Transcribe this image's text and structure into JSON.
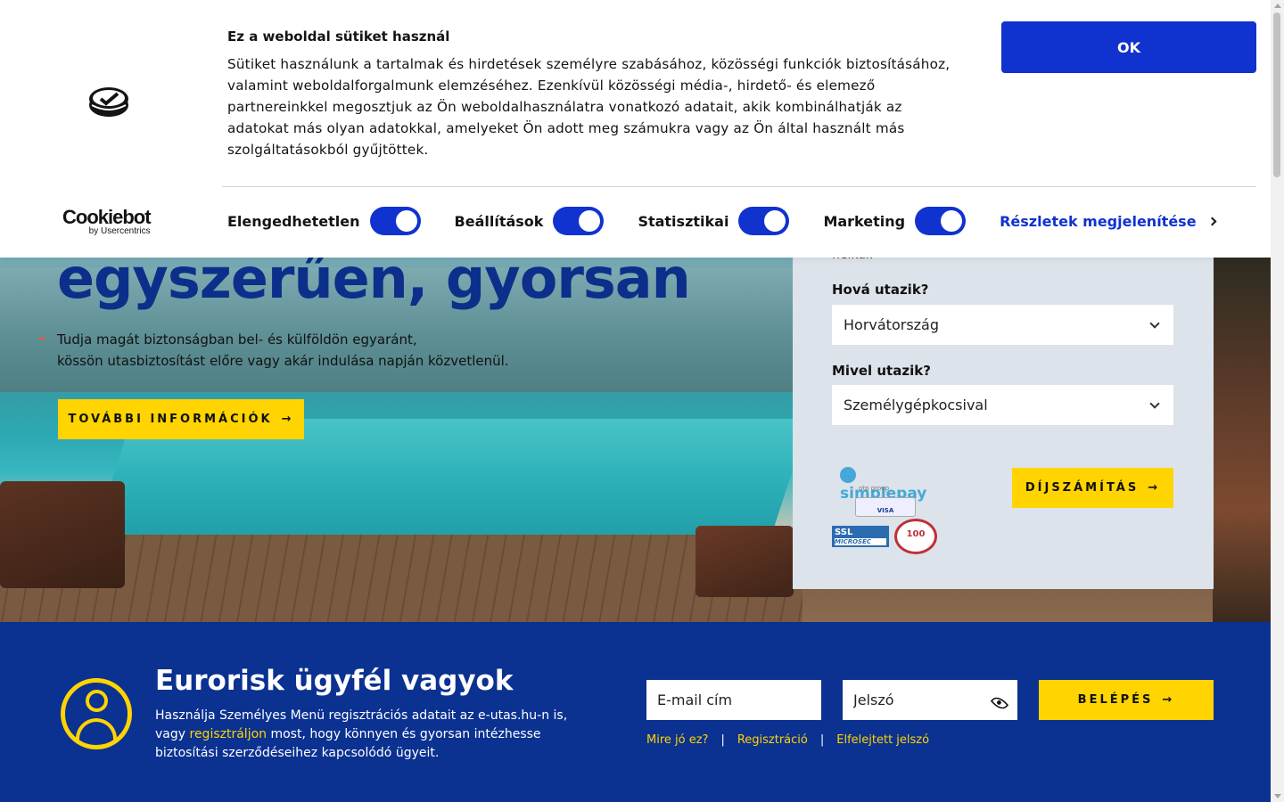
{
  "hero": {
    "title": "egyszerűen, gyorsan",
    "line1": "Tudja magát biztonságban bel- és külföldön egyaránt,",
    "line2": "kössön utasbiztosítást előre vagy akár indulása napján közvetlenül.",
    "button_label": "TOVÁBBI INFORMÁCIÓK",
    "button_arrow": "→"
  },
  "calculator": {
    "clipped_text": "nélkül.",
    "destination_label": "Hová utazik?",
    "destination_value": "Horvátország",
    "transport_label": "Mivel utazik?",
    "transport_value": "Személygépkocsival",
    "button_label": "DÍJSZÁMÍTÁS",
    "button_arrow": "→",
    "badges": {
      "simplepay": "simplepay",
      "otp": "otp group",
      "cards": "VISA",
      "ssl": "SSL",
      "ssl_sub": "MICROSEC",
      "seal": "100"
    }
  },
  "login": {
    "title": "Eurorisk ügyfél vagyok",
    "text_before": "Használja Személyes Menü regisztrációs adatait az e-utas.hu-n is, vagy ",
    "text_link": "regisztráljon",
    "text_after": " most, hogy könnyen és gyorsan intézhesse biztosítási szerződéseihez kapcsolódó ügyeit.",
    "email_placeholder": "E-mail cím",
    "password_placeholder": "Jelszó",
    "button_label": "BELÉPÉS",
    "button_arrow": "→",
    "links": [
      "Mire jó ez?",
      "Regisztráció",
      "Elfelejtett jelszó"
    ],
    "separator": "|"
  },
  "cookie": {
    "title": "Ez a weboldal sütiket használ",
    "text": "Sütiket használunk a tartalmak és hirdetések személyre szabásához, közösségi funkciók biztosításához, valamint weboldalforgalmunk elemzéséhez. Ezenkívül közösségi média-, hirdető- és elemező partnereinkkel megosztjuk az Ön weboldalhasználatra vonatkozó adatait, akik kombinálhatják az adatokat más olyan adatokkal, amelyeket Ön adott meg számukra vagy az Ön által használt más szolgáltatásokból gyűjtöttek.",
    "ok_label": "OK",
    "brand_name": "Cookiebot",
    "brand_sub": "by Usercentrics",
    "toggles": [
      {
        "label": "Elengedhetetlen",
        "on": true
      },
      {
        "label": "Beállítások",
        "on": true
      },
      {
        "label": "Statisztikai",
        "on": true
      },
      {
        "label": "Marketing",
        "on": true
      }
    ],
    "details_label": "Részletek megjelenítése",
    "accent_color": "#1032cf"
  },
  "colors": {
    "brand_blue": "#0b3191",
    "accent_yellow": "#ffd400",
    "form_bg": "#dde3ea"
  }
}
